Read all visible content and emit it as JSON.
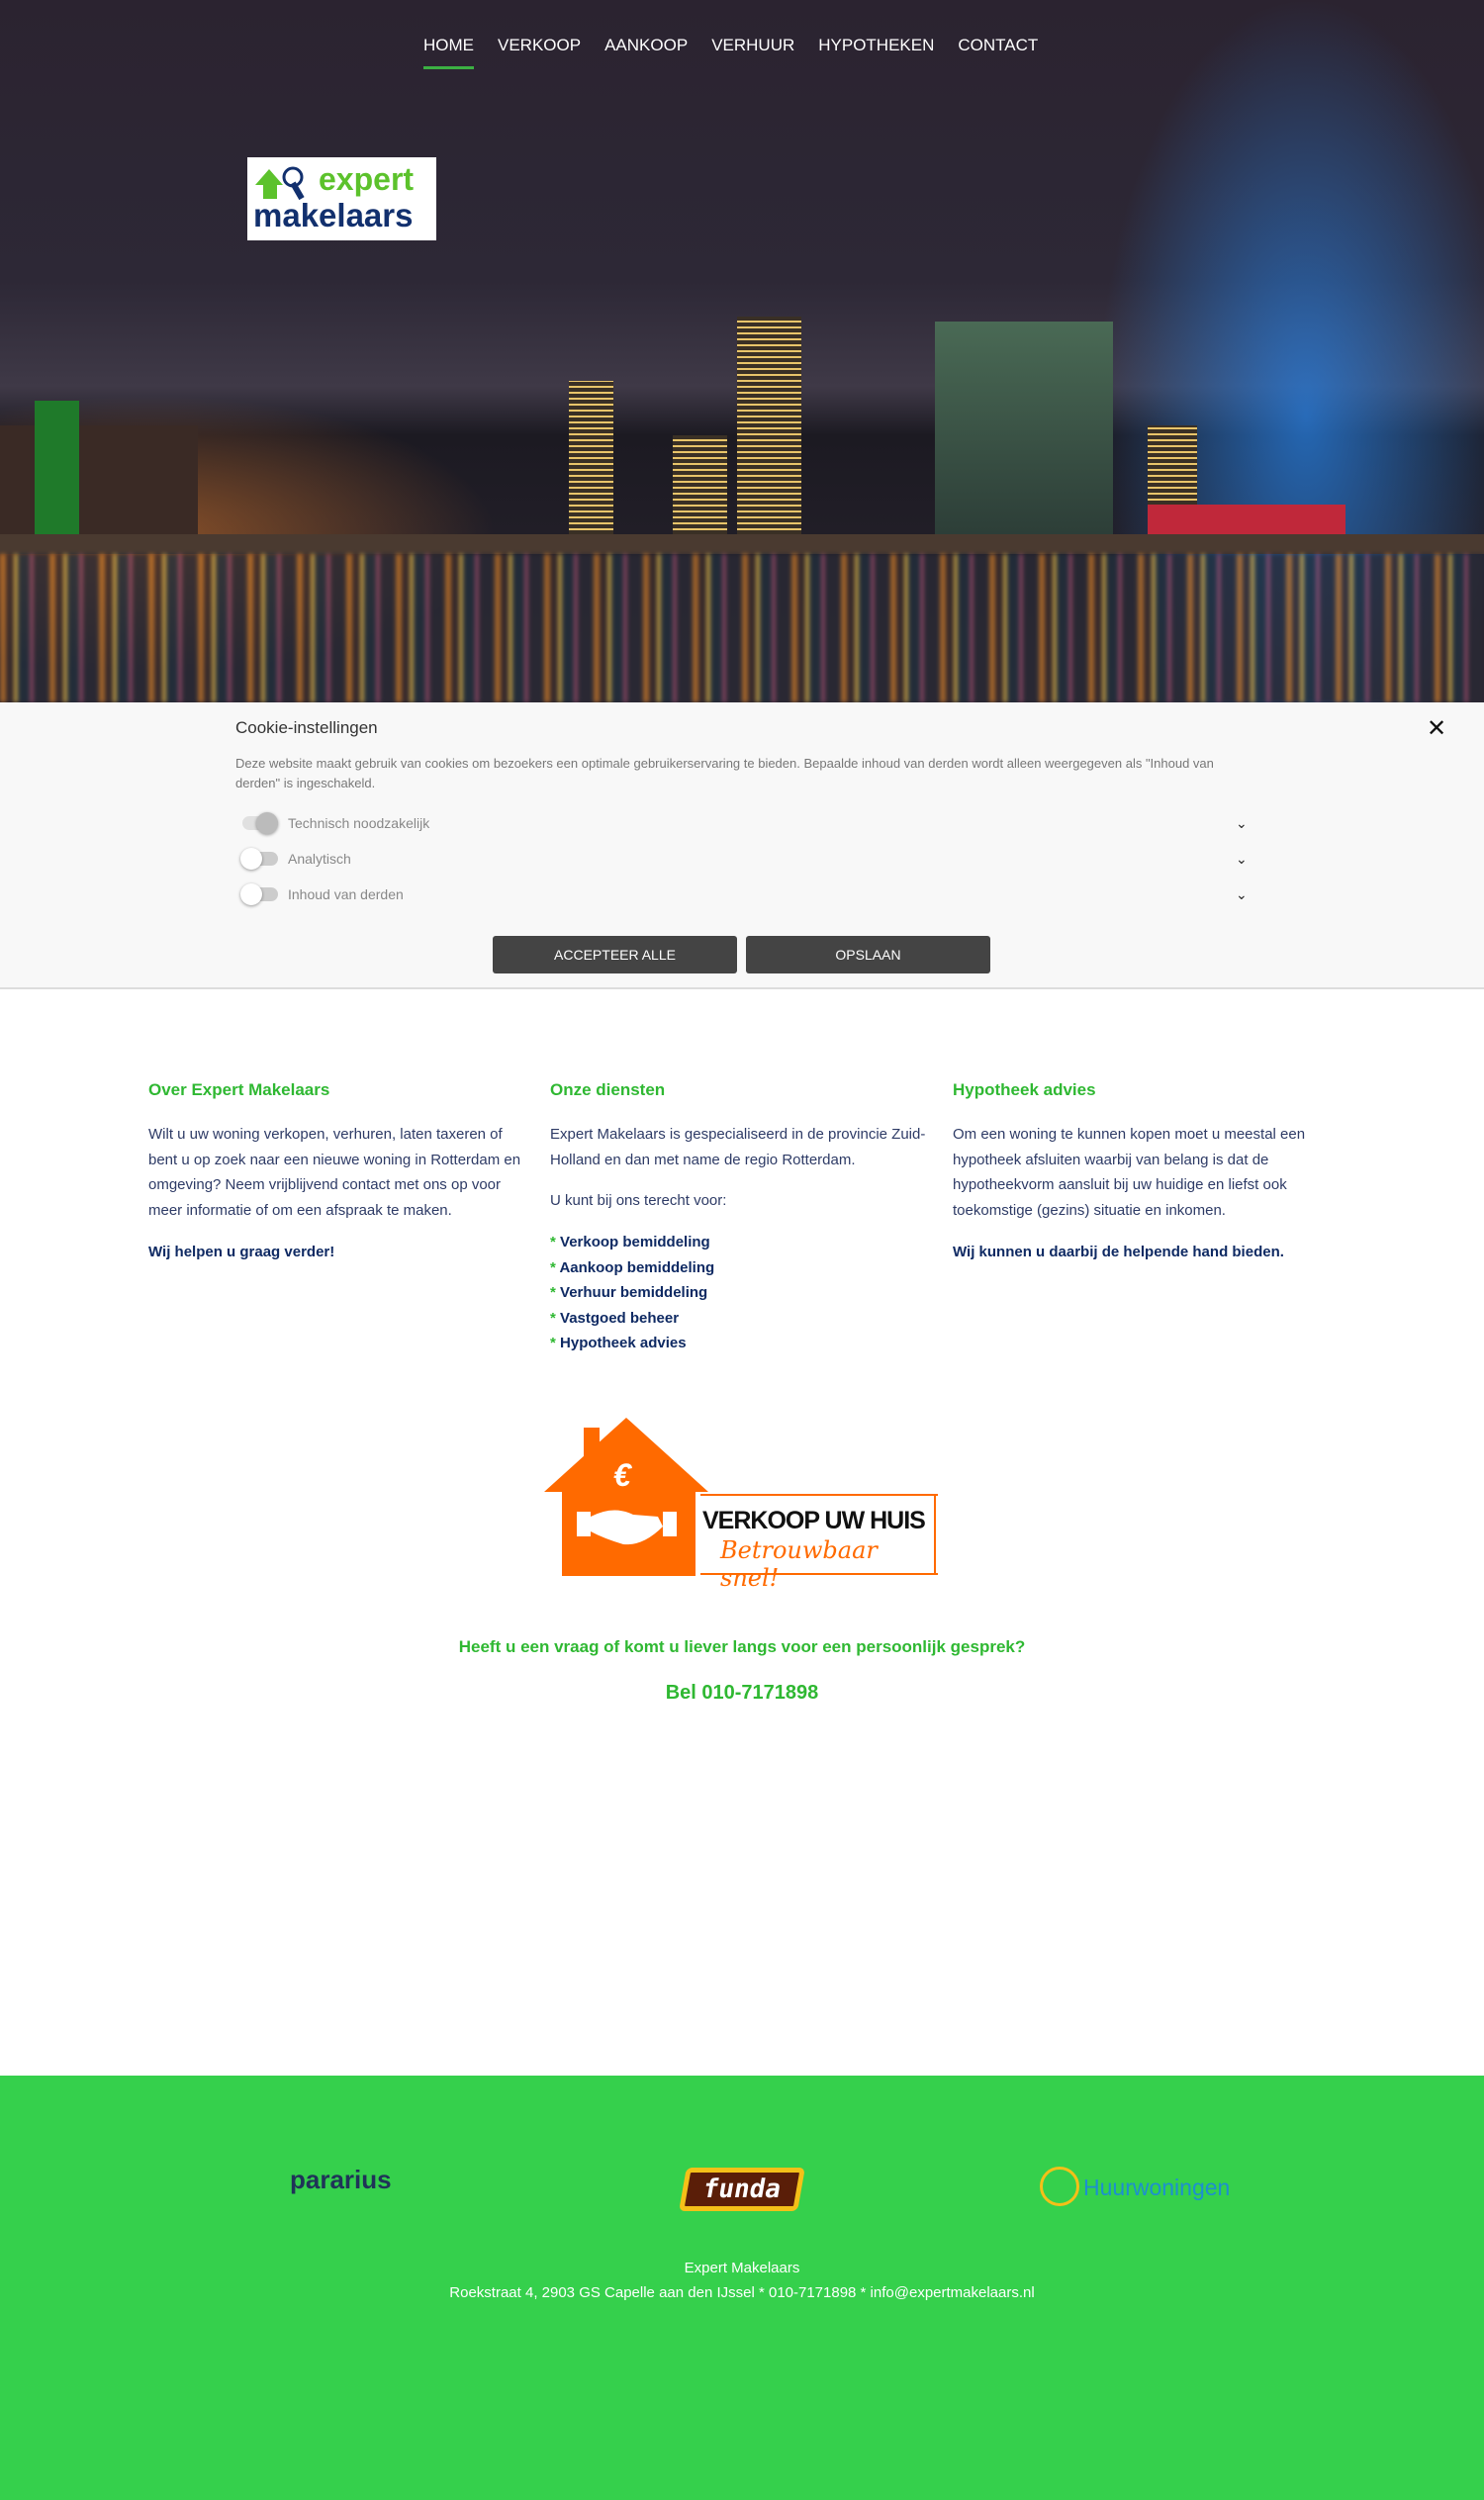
{
  "nav": {
    "items": [
      {
        "label": "HOME",
        "active": true
      },
      {
        "label": "VERKOOP"
      },
      {
        "label": "AANKOOP"
      },
      {
        "label": "VERHUUR"
      },
      {
        "label": "HYPOTHEKEN"
      },
      {
        "label": "CONTACT"
      }
    ]
  },
  "logo": {
    "line1": "expert",
    "line2": "makelaars"
  },
  "cookie": {
    "title": "Cookie-instellingen",
    "close_icon": "close-icon",
    "text": "Deze website maakt gebruik van cookies om bezoekers een optimale gebruikerservaring te bieden. Bepaalde inhoud van derden wordt alleen weergegeven als \"Inhoud van derden\" is ingeschakeld.",
    "options": [
      {
        "label": "Technisch noodzakelijk",
        "enabled": true
      },
      {
        "label": "Analytisch",
        "enabled": false
      },
      {
        "label": "Inhoud van derden",
        "enabled": false
      }
    ],
    "accept_all": "ACCEPTEER ALLE",
    "save": "OPSLAAN"
  },
  "columns": [
    {
      "title": "Over Expert Makelaars",
      "text": "Wilt u uw woning verkopen, verhuren, laten taxeren of bent u op zoek naar een nieuwe woning in Rotterdam en omgeving? Neem vrijblijvend contact met ons op voor meer informatie of om een afspraak te maken.",
      "bold": "Wij helpen u graag verder!"
    },
    {
      "title": "Onze diensten",
      "text": "Expert Makelaars is gespecialiseerd in de provincie Zuid-Holland en dan met name de regio Rotterdam.",
      "text2": "U kunt bij ons terecht voor:",
      "bullet": "*",
      "list": [
        "Verkoop bemiddeling",
        "Aankoop bemiddeling",
        "Verhuur bemiddeling",
        "Vastgoed beheer",
        "Hypotheek advies"
      ]
    },
    {
      "title": "Hypotheek advies",
      "text": "Om een woning te kunnen kopen moet u meestal een hypotheek afsluiten waarbij van belang is dat de hypotheekvorm aansluit bij uw huidige en liefst ook toekomstige (gezins) situatie en inkomen.",
      "bold": "Wij kunnen u daarbij de helpende hand bieden."
    }
  ],
  "promo": {
    "title": "VERKOOP UW HUIS",
    "subtitle": "Betrouwbaar snel!",
    "symbol": "€"
  },
  "contact": {
    "question": "Heeft u een vraag of komt u liever langs voor een persoonlijk gesprek?",
    "phone": "Bel 010-7171898"
  },
  "footer": {
    "partners": [
      "pararius",
      "funda",
      "Huurwoningen"
    ],
    "company": "Expert Makelaars",
    "address": "Roekstraat 4, 2903 GS Capelle aan den IJssel * 010-7171898 * info@expertmakelaars.nl"
  },
  "colors": {
    "green": "#2fb832",
    "footer": "#35d04c",
    "navy": "#0f2a63",
    "orange": "#ff6a00"
  }
}
